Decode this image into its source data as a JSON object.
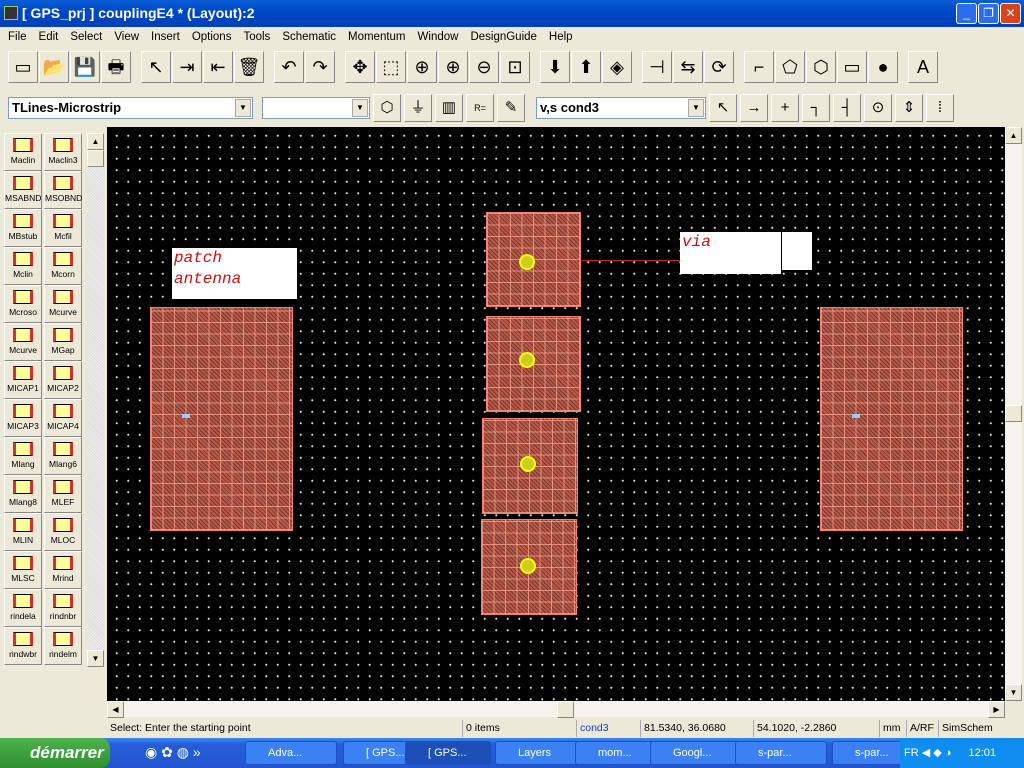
{
  "window": {
    "title": "[ GPS_prj ] couplingE4 * (Layout):2"
  },
  "menu": [
    "File",
    "Edit",
    "Select",
    "View",
    "Insert",
    "Options",
    "Tools",
    "Schematic",
    "Momentum",
    "Window",
    "DesignGuide",
    "Help"
  ],
  "toolbar": {
    "icons": [
      "new-icon",
      "open-icon",
      "save-icon",
      "print-icon",
      "select-arrow-icon",
      "insert-component-icon",
      "insert-wire-icon",
      "delete-icon",
      "undo-icon",
      "redo-icon",
      "pan-icon",
      "zoom-window-icon",
      "zoom-icon",
      "zoom-in-2-icon",
      "zoom-out-2-icon",
      "zoom-fit-icon",
      "push-down-icon",
      "pop-up-icon",
      "layers-icon",
      "port-icon",
      "mirror-icon",
      "rotate-icon",
      "trace-icon",
      "polygon-icon",
      "polyline-icon",
      "rectangle-icon",
      "circle-icon",
      "text-icon"
    ],
    "glyphs": [
      "▭",
      "📂",
      "💾",
      "🖶",
      "↖",
      "⇥",
      "⇤",
      "🗑",
      "↶",
      "↷",
      "✥",
      "⬚",
      "⊕",
      "⊕",
      "⊖",
      "⊡",
      "⬇",
      "⬆",
      "◈",
      "⊣",
      "⇆",
      "⟳",
      "⌐",
      "⬠",
      "⬡",
      "▭",
      "●",
      "A"
    ]
  },
  "library_combo": "TLines-Microstrip",
  "component_combo": "",
  "layer_combo": "v,s cond3",
  "palette": [
    "Maclin",
    "Maclin3",
    "MSABND",
    "MSOBND",
    "MBstub",
    "Mcfil",
    "Mclin",
    "Mcorn",
    "Mcroso",
    "Mcurve",
    "Mcurve",
    "MGap",
    "MICAP1",
    "MICAP2",
    "MICAP3",
    "MICAP4",
    "Mlang",
    "Mlang6",
    "Mlang8",
    "MLEF",
    "MLIN",
    "MLOC",
    "MLSC",
    "Mrind",
    "rindela",
    "rindnbr",
    "rindwbr",
    "rindelm"
  ],
  "layout": {
    "label_patch_1": "patch",
    "label_patch_2": "antenna",
    "label_via": "via"
  },
  "status": {
    "prompt": "Select: Enter the starting point",
    "items": "0 items",
    "layer": "cond3",
    "coord1": "81.5340, 36.0680",
    "coord2": "54.1020, -2.2860",
    "units": "mm",
    "mode": "A/RF",
    "sim": "SimSchem"
  },
  "taskbar": {
    "start": "démarrer",
    "tasks": [
      "Adva...",
      "[ GPS...",
      "[ GPS...",
      "Layers",
      "mom...",
      "Googl...",
      "s-par...",
      "s-par..."
    ],
    "lang": "FR",
    "clock": "12:01"
  }
}
